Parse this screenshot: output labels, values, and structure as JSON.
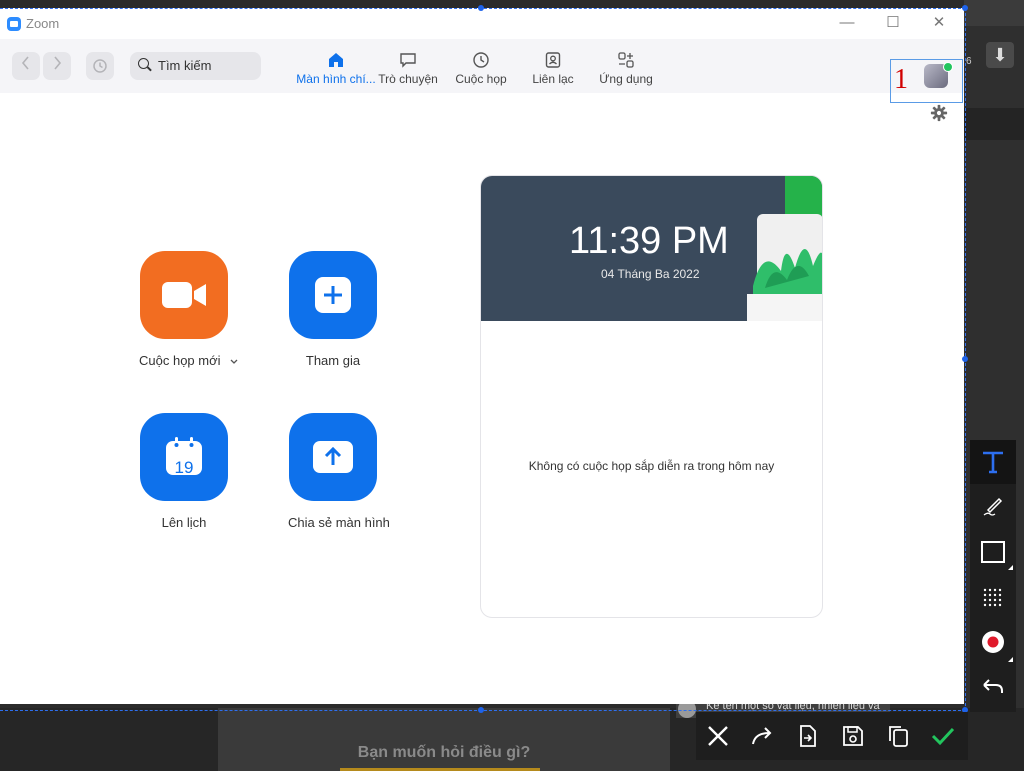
{
  "window": {
    "app_title": "Zoom",
    "controls": {
      "minimize": "—",
      "maximize": "☐",
      "close": "✕"
    }
  },
  "toolbar": {
    "back_icon": "chevron-left-icon",
    "forward_icon": "chevron-right-icon",
    "history_icon": "history-icon",
    "search_placeholder": "Tìm kiếm",
    "tabs": [
      {
        "label": "Màn hình chí...",
        "icon": "home-icon",
        "active": true
      },
      {
        "label": "Trò chuyện",
        "icon": "chat-icon",
        "active": false
      },
      {
        "label": "Cuộc họp",
        "icon": "clock-icon",
        "active": false
      },
      {
        "label": "Liên lạc",
        "icon": "contacts-icon",
        "active": false
      },
      {
        "label": "Ứng dụng",
        "icon": "apps-icon",
        "active": false
      }
    ],
    "annotation_number": "1",
    "side_badge": "6"
  },
  "actions": [
    {
      "label": "Cuộc họp mới",
      "has_dropdown": true,
      "icon": "video-camera-icon",
      "color": "#f26d21"
    },
    {
      "label": "Tham gia",
      "icon": "plus-icon",
      "color": "#0e71eb"
    },
    {
      "label": "Lên lịch",
      "icon": "calendar-icon",
      "calendar_day": "19",
      "color": "#0e71eb"
    },
    {
      "label": "Chia sẻ màn hình",
      "icon": "share-arrow-icon",
      "color": "#0e71eb"
    }
  ],
  "calendar": {
    "time": "11:39 PM",
    "date": "04 Tháng Ba 2022",
    "empty_message": "Không có cuộc họp sắp diễn ra trong hôm nay"
  },
  "background": {
    "ask_prompt": "Bạn muốn hỏi điều gì?",
    "chat_snippet": "Kể tên một số vật liệu, nhiên liệu và"
  },
  "capture_tools": {
    "vertical": [
      "text-tool-icon",
      "pen-icon",
      "rectangle-icon",
      "mosaic-icon",
      "record-icon",
      "undo-icon"
    ],
    "horizontal": [
      "cancel-icon",
      "share-icon",
      "export-icon",
      "save-icon",
      "copy-icon",
      "confirm-icon"
    ]
  },
  "colors": {
    "zoom_blue": "#0e71eb",
    "zoom_orange": "#f26d21",
    "selection_blue": "#2d6ff0",
    "confirm_green": "#22c55e",
    "annotation_red": "#d10000"
  }
}
